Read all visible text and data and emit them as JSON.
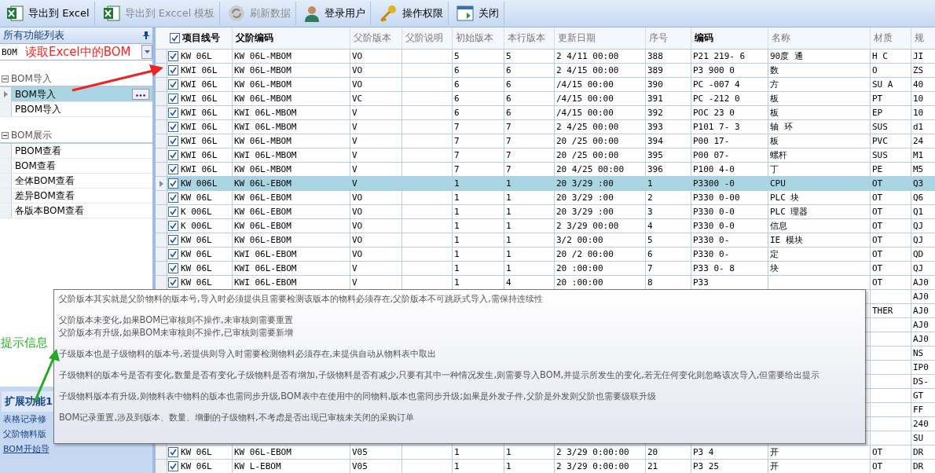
{
  "toolbar": [
    {
      "label": "导出到 Excel",
      "kind": "excel",
      "disabled": false
    },
    {
      "label": "导出到 Exccel 模板",
      "kind": "excel",
      "disabled": true
    },
    {
      "label": "刷新数据",
      "kind": "refresh",
      "disabled": true
    },
    {
      "label": "登录用户",
      "kind": "user",
      "disabled": false
    },
    {
      "label": "操作权限",
      "kind": "key",
      "disabled": false
    },
    {
      "label": "关闭",
      "kind": "window",
      "disabled": false
    }
  ],
  "function_panel": {
    "title": "所有功能列表",
    "combo_value": "BOM",
    "groups": [
      {
        "label": "BOM导入",
        "items": [
          {
            "label": "BOM导入",
            "selected": true
          },
          {
            "label": "PBOM导入",
            "selected": false
          }
        ]
      },
      {
        "label": "BOM展示",
        "items": [
          {
            "label": "PBOM查看",
            "selected": false
          },
          {
            "label": "BOM查看",
            "selected": false
          },
          {
            "label": "全体BOM查看",
            "selected": false
          },
          {
            "label": "差异BOM查看",
            "selected": false
          },
          {
            "label": "各版本BOM查看",
            "selected": false
          }
        ]
      }
    ]
  },
  "extension_panel": {
    "title": "扩展功能1",
    "links": [
      "表格记录修",
      "父阶物料版",
      "BOM开始导"
    ]
  },
  "annotations": {
    "combo_note": "读取Excel中的BOM",
    "tooltip_note": "提示信息"
  },
  "grid": {
    "header_checked": true,
    "columns": [
      {
        "label": "项目线号",
        "emphasis": true
      },
      {
        "label": "父阶编码",
        "emphasis": true
      },
      {
        "label": "父阶版本",
        "emphasis": false
      },
      {
        "label": "父阶说明",
        "emphasis": false
      },
      {
        "label": "初始版本",
        "emphasis": false
      },
      {
        "label": "本行版本",
        "emphasis": false
      },
      {
        "label": "更新日期",
        "emphasis": false
      },
      {
        "label": "序号",
        "emphasis": false
      },
      {
        "label": "编码",
        "emphasis": true
      },
      {
        "label": "名称",
        "emphasis": false
      },
      {
        "label": "材质",
        "emphasis": false
      },
      {
        "label": "规",
        "emphasis": false
      }
    ],
    "rows": [
      {
        "checked": true,
        "selected": false,
        "cells": [
          "KW 06L",
          "KW 06L-MBOM",
          "VO",
          null,
          "5",
          "5",
          "2 4/11 00:00",
          "388",
          "P21 219- 6",
          "90度 通",
          "H C",
          "JI"
        ]
      },
      {
        "checked": true,
        "selected": false,
        "cells": [
          "KWI 06L",
          "KW 06L-MBOM",
          "VO",
          null,
          "6",
          "6",
          "2 4/15 00:00",
          "389",
          "P3 900 0",
          "数",
          "O",
          "ZS"
        ]
      },
      {
        "checked": true,
        "selected": false,
        "cells": [
          "KWI 06L",
          "KW 06L-MBOM",
          "VO",
          null,
          "6",
          "6",
          "/4/15 00:00",
          "390",
          "PC -007 4",
          "方",
          "SU A",
          "40"
        ]
      },
      {
        "checked": true,
        "selected": false,
        "cells": [
          "KWI 06L",
          "KW 06L-MBOM",
          "VC",
          null,
          "6",
          "6",
          "/4/15 00:00",
          "391",
          "PC -212 0",
          "板",
          "PT",
          "10"
        ]
      },
      {
        "checked": true,
        "selected": false,
        "cells": [
          "KWI 06L",
          "KWI 06L-MBOM",
          "V",
          null,
          "6",
          "6",
          "/4/15 00:00",
          "392",
          "POC 23 0",
          "板",
          "EP",
          "10"
        ]
      },
      {
        "checked": true,
        "selected": false,
        "cells": [
          "KWI 06L",
          "KWI 06L-MBOM",
          "V",
          null,
          "7",
          "7",
          "2 4/25 00:00",
          "393",
          "P101 7- 3",
          "轴 环",
          "SUS",
          "d1"
        ]
      },
      {
        "checked": true,
        "selected": false,
        "cells": [
          "KWI 06L",
          "KW 06L-MBOM",
          "V",
          null,
          "7",
          "7",
          "20 /25 00:00",
          "394",
          "P00 17-",
          "板",
          "PVC",
          "24"
        ]
      },
      {
        "checked": true,
        "selected": false,
        "cells": [
          "KWI 06L",
          "KWI 06L-MBOM",
          "V",
          null,
          "7",
          "7",
          "20 /25 00:00",
          "395",
          "P00 07-",
          "螺杆",
          "SUS",
          "M1"
        ]
      },
      {
        "checked": true,
        "selected": false,
        "cells": [
          "KWI 06L",
          "KW 06L-MBOM",
          "V",
          null,
          "7",
          "7",
          "20 4/25 00:00",
          "396",
          "P100 4-0",
          "丁",
          "PE",
          "M5"
        ]
      },
      {
        "checked": true,
        "selected": true,
        "cells": [
          "KW 006L",
          "KW 06L-EBOM",
          "V",
          null,
          "1",
          "1",
          "20 3/29 :00",
          "1",
          "P3300 -0",
          "CPU",
          "OT",
          "Q3"
        ]
      },
      {
        "checked": true,
        "selected": false,
        "cells": [
          "KW 06L",
          "KW 06L-EBOM",
          "VO",
          null,
          "1",
          "1",
          "20 3/29 :00",
          "2",
          "P330 0-00",
          "PLC 块",
          "OT",
          "Q6"
        ]
      },
      {
        "checked": true,
        "selected": false,
        "cells": [
          "K 006L",
          "KW 06L-EBOM",
          "VO",
          null,
          "1",
          "1",
          "20 3/29 :00",
          "3",
          "P330 0-0",
          "PLC 理器",
          "OT",
          "Q1"
        ]
      },
      {
        "checked": true,
        "selected": false,
        "cells": [
          "K 006L",
          "KW 06L-EBOM",
          "VO",
          null,
          "1",
          "1",
          "2 3/29 00:00",
          "4",
          "P330 0-0",
          "信息",
          "OT",
          "QJ"
        ]
      },
      {
        "checked": true,
        "selected": false,
        "cells": [
          "KW 06L",
          "KW 06L-EBOM",
          "VO",
          null,
          "1",
          "1",
          "3/2 00:00",
          "5",
          "P330 0-",
          "IE 模块",
          "OT",
          "QJ"
        ]
      },
      {
        "checked": true,
        "selected": false,
        "cells": [
          "KW 06L",
          "KWI 06L-EBOM",
          "VO",
          null,
          "1",
          "1",
          "20 /2 00:00",
          "6",
          "P330 0-",
          "定",
          "OT",
          "QD"
        ]
      },
      {
        "checked": true,
        "selected": false,
        "cells": [
          "KW 06L",
          "KWI 06L-EBOM",
          "V",
          null,
          "1",
          "1",
          "20 :00:00",
          "7",
          "P33 0- 8",
          "块",
          "OT",
          "QJ"
        ]
      },
      {
        "checked": true,
        "selected": false,
        "cells": [
          "KW 06L",
          "KWI 06L-EBOM",
          "V",
          null,
          "1",
          "4",
          "20 :00:00",
          "8",
          "P33",
          null,
          "OT",
          "AJ0"
        ]
      },
      {
        "cells": [
          null,
          null,
          null,
          null,
          null,
          null,
          null,
          null,
          null,
          null,
          null,
          "AJ0"
        ]
      },
      {
        "cells": [
          null,
          null,
          null,
          null,
          null,
          null,
          null,
          null,
          null,
          null,
          "THER",
          "AJ0"
        ]
      },
      {
        "cells": [
          null,
          null,
          null,
          null,
          null,
          null,
          null,
          null,
          null,
          null,
          null,
          "AJ0"
        ]
      },
      {
        "cells": [
          null,
          null,
          null,
          null,
          null,
          null,
          null,
          null,
          null,
          null,
          null,
          "AJ0"
        ]
      },
      {
        "cells": [
          null,
          null,
          null,
          null,
          null,
          null,
          null,
          null,
          null,
          null,
          null,
          "NS"
        ]
      },
      {
        "cells": [
          null,
          null,
          null,
          null,
          null,
          null,
          null,
          null,
          null,
          null,
          null,
          "IP0"
        ]
      },
      {
        "cells": [
          null,
          null,
          null,
          null,
          null,
          null,
          null,
          null,
          null,
          null,
          null,
          "DS-"
        ]
      },
      {
        "cells": [
          null,
          null,
          null,
          null,
          null,
          null,
          null,
          null,
          null,
          null,
          null,
          "GT"
        ]
      },
      {
        "cells": [
          null,
          null,
          null,
          null,
          null,
          null,
          null,
          null,
          null,
          null,
          null,
          "FF"
        ]
      },
      {
        "cells": [
          null,
          null,
          null,
          null,
          null,
          null,
          null,
          null,
          null,
          null,
          null,
          "240"
        ]
      },
      {
        "cells": [
          null,
          null,
          null,
          null,
          null,
          null,
          null,
          null,
          null,
          null,
          null,
          "SU"
        ]
      },
      {
        "checked": true,
        "selected": false,
        "cells": [
          "KW 06L",
          "KW 06L-EBOM",
          "V05",
          null,
          "1",
          "1",
          "2 3/29 0:00:00",
          "20",
          "P3 4",
          "开",
          "OT",
          "DR"
        ]
      },
      {
        "checked": true,
        "selected": false,
        "cells": [
          "KW 06L",
          "KW L-EBOM",
          "V05",
          null,
          "1",
          "1",
          "2 3/29 0:00:00",
          "21",
          "P3 25",
          "开",
          "OT",
          "DR"
        ]
      }
    ]
  },
  "tooltip": {
    "paragraphs": [
      [
        "父阶版本其实就是父阶物料的版本号,导入时必须提供且需要检测该版本的物料必须存在,父阶版本不可跳跃式导入,需保持连续性"
      ],
      [
        "父阶版本未变化,如果BOM已审核则不操作,未审核则需要重置",
        "父阶版本有升级,如果BOM未审核则不操作,已审核则需要新增"
      ],
      [
        "子级版本也是子级物料的版本号,若提供则导入时需要检测物料必须存在,未提供自动从物料表中取出"
      ],
      [
        "子级物料的版本号是否有变化,数量是否有变化,子级物料是否有增加,子级物料是否有减少,只要有其中一种情况发生,则需要导入BOM,并提示所发生的变化,若无任何变化则忽略该次导入,但需要给出提示"
      ],
      [
        "子级物料版本有升级,则物料表中物料的版本也需同步升级,BOM表中在使用中的同物料,版本也需同步升级;如果是外发子件,父阶是外发则父阶也需要级联升级"
      ],
      [
        "BOM记录重置,涉及到版本、数量、增删的子级物料,不考虑是否出现已审核未关闭的采购订单"
      ]
    ]
  }
}
